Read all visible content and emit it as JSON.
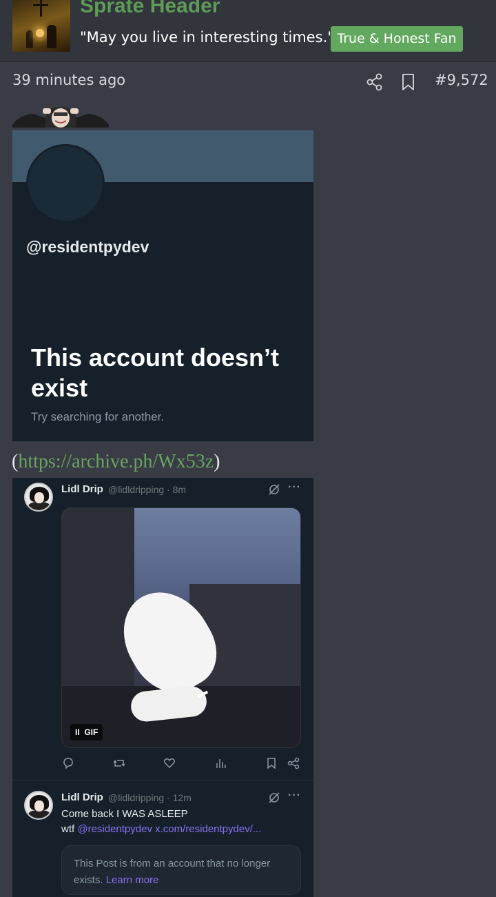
{
  "user": {
    "name": "Sprate Header",
    "title": "\"May you live in interesting times.\"",
    "badge": "True & Honest Fan"
  },
  "post": {
    "time": "39 minutes ago",
    "number": "#9,572",
    "link_open": "(",
    "archive_url": "https://archive.ph/Wx53z",
    "link_close": ")"
  },
  "x_screenshot": {
    "handle": "@residentpydev",
    "heading": "This account doesn’t exist",
    "subtext": "Try searching for another."
  },
  "tweet_screenshot": {
    "first": {
      "name": "Lidl Drip",
      "handle_time": "@lidldripping · 8m",
      "more": "···",
      "gif_label": "GIF",
      "pause": "II"
    },
    "second": {
      "name": "Lidl Drip",
      "handle_time": "@lidldripping · 12m",
      "more": "···",
      "line1": "Come back I WAS ASLEEP",
      "line2_prefix": "wtf ",
      "line2_link": "@residentpydev x.com/residentpydev/...",
      "notice": "This Post is from an account that no longer exists.",
      "learn_more": "Learn more"
    }
  },
  "colors": {
    "background": "#393c44",
    "username": "#5e9a58",
    "badge": "#62a85e",
    "link": "#6aa464",
    "x_bg": "#15202b"
  },
  "icons": [
    "share-icon",
    "bookmark-icon",
    "reply-icon",
    "retweet-icon",
    "like-icon",
    "views-icon",
    "grok-icon"
  ]
}
